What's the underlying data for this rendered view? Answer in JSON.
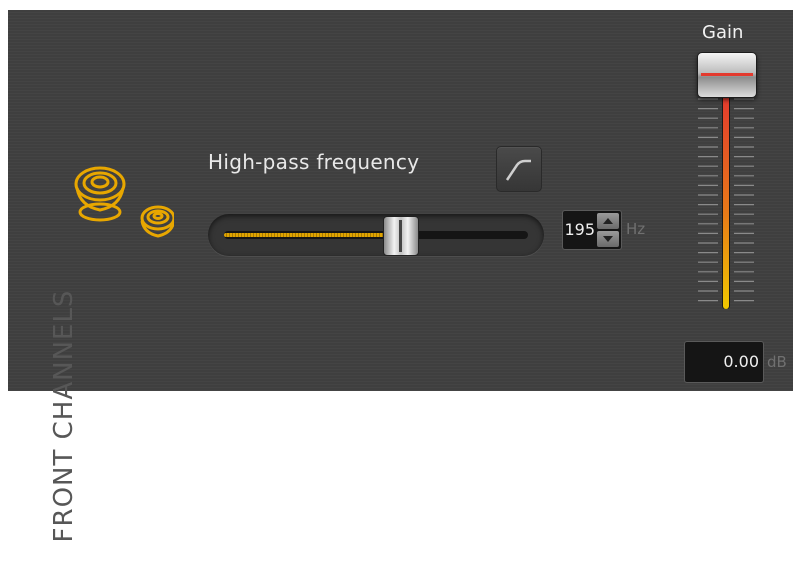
{
  "panel": {
    "title": "FRONT CHANNELS"
  },
  "high_pass": {
    "label": "High-pass frequency",
    "slider_fraction": 0.58,
    "value": "195",
    "unit": "Hz",
    "filter_icon": "high-pass-curve-icon"
  },
  "gain": {
    "label": "Gain",
    "value": "0.00",
    "unit": "dB",
    "level_fraction": 1.0
  },
  "icons": {
    "speakers": "speakers-icon",
    "spin_up": "chevron-up-icon",
    "spin_down": "chevron-down-icon"
  },
  "colors": {
    "background": "#3f3f3f",
    "accent": "#e0a400",
    "meter_top": "#e43a2e",
    "meter_bottom": "#f0c800"
  }
}
